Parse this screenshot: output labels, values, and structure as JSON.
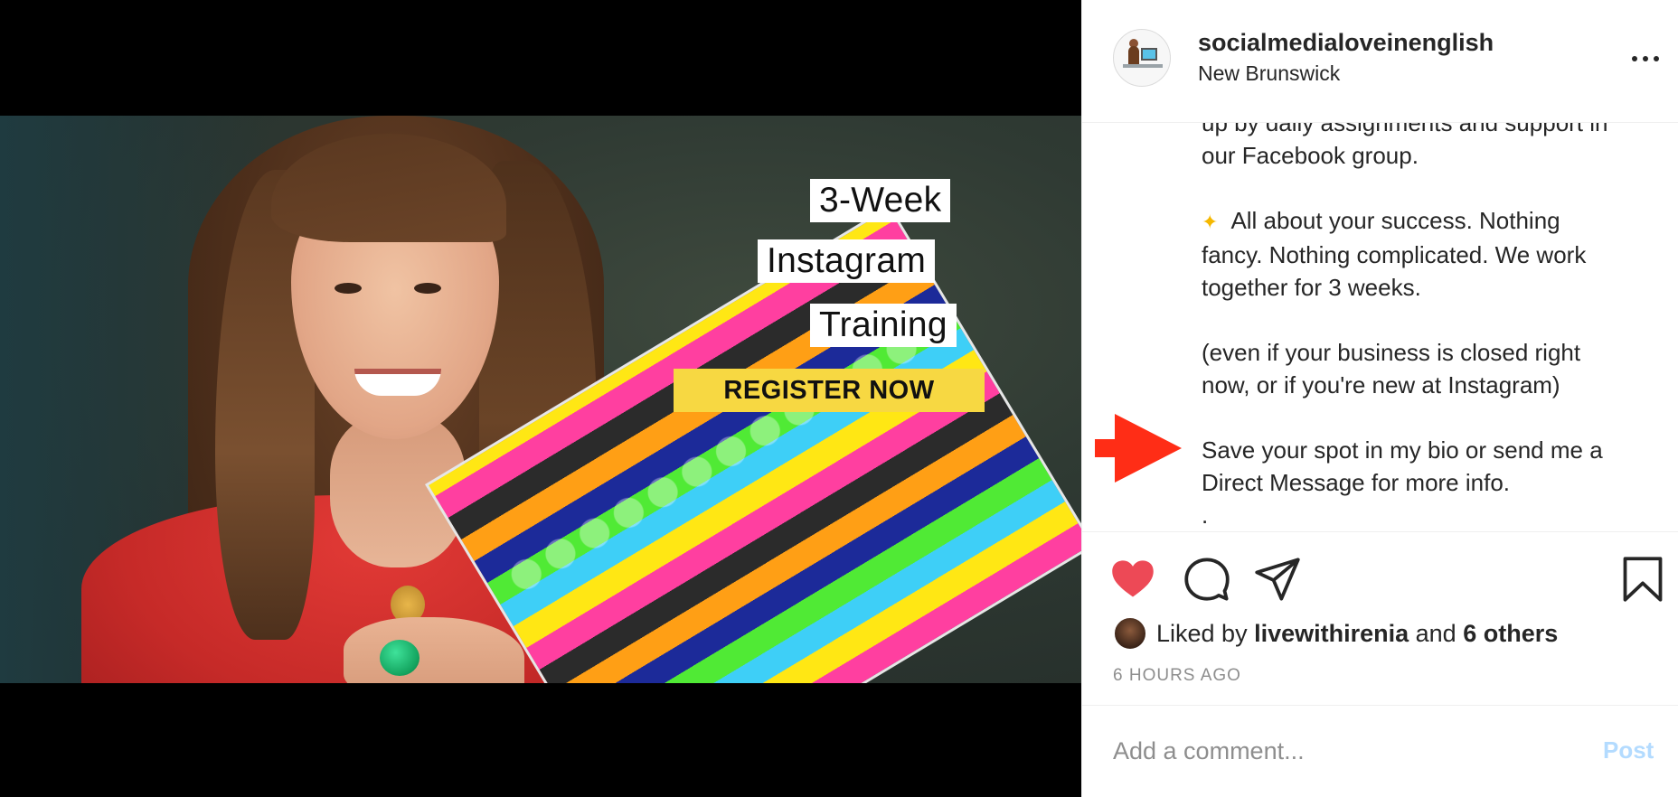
{
  "post": {
    "overlay": {
      "line1": "3-Week",
      "line2": "Instagram",
      "line3": "Training",
      "cta": "REGISTER NOW"
    }
  },
  "header": {
    "username": "socialmedialoveinenglish",
    "location": "New Brunswick",
    "more_icon": "more-options-icon"
  },
  "caption": {
    "lines": [
      "up by daily assignments and support in",
      "our Facebook group.",
      "",
      "All about your success. Nothing",
      "fancy. Nothing complicated. We work",
      "together for 3 weeks.",
      "",
      "(even if your business is closed right",
      "now, or if you're new at Instagram)",
      "",
      "Save your spot in my bio or send me a",
      "Direct Message for more info.",
      "."
    ],
    "annotation_arrow_color": "#ff2d16"
  },
  "actions": {
    "like_icon": "heart-icon",
    "like_color": "#ed4956",
    "comment_icon": "comment-icon",
    "share_icon": "share-icon",
    "save_icon": "bookmark-icon"
  },
  "likes": {
    "prefix": "Liked by ",
    "user": "livewithirenia",
    "and": " and ",
    "others": "6 others"
  },
  "timestamp": "6 HOURS AGO",
  "comment": {
    "placeholder": "Add a comment...",
    "post_label": "Post"
  }
}
